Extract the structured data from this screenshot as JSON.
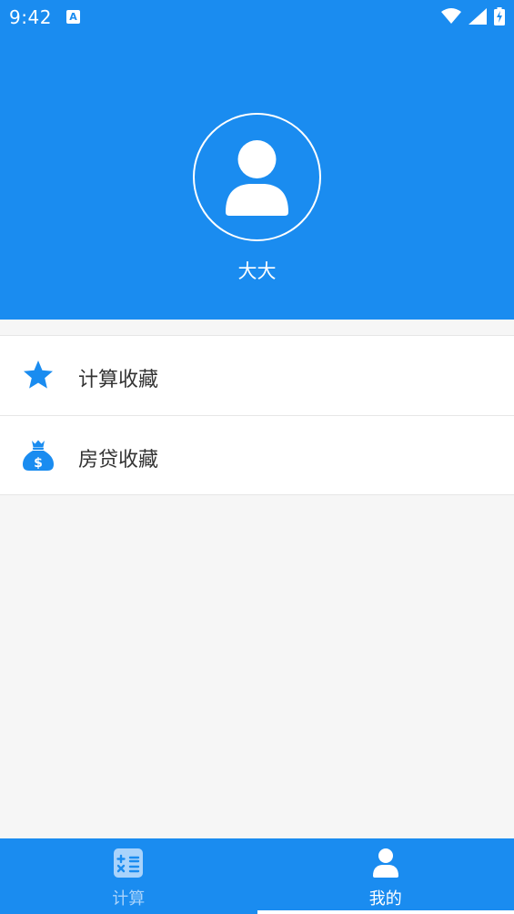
{
  "status_bar": {
    "time": "9:42",
    "notification_icon": "a-icon",
    "icons": [
      "wifi-icon",
      "signal-icon",
      "battery-charging-icon"
    ]
  },
  "profile": {
    "avatar_icon": "person-icon",
    "username": "大大"
  },
  "menu": {
    "items": [
      {
        "label": "计算收藏",
        "icon": "star-icon"
      },
      {
        "label": "房贷收藏",
        "icon": "money-bag-icon"
      }
    ]
  },
  "tabbar": {
    "tabs": [
      {
        "label": "计算",
        "icon": "calculator-icon",
        "active": false
      },
      {
        "label": "我的",
        "icon": "person-icon",
        "active": true
      }
    ]
  },
  "colors": {
    "primary": "#1a8cf0",
    "background": "#f6f6f6",
    "text": "#333333",
    "tab_inactive": "#a9d3fb"
  }
}
